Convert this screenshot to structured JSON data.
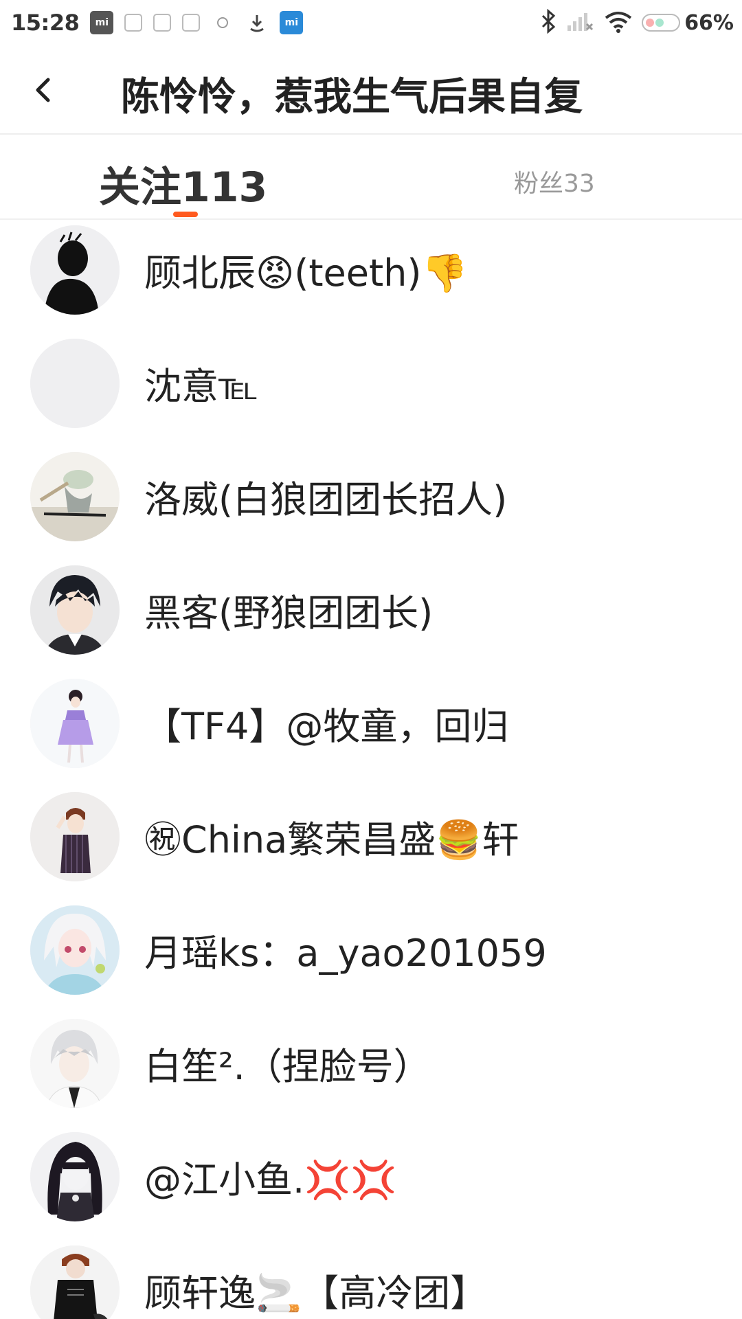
{
  "status_bar": {
    "time": "15:28",
    "battery": "66%",
    "notification_icons": [
      "mi-app-icon",
      "app-icon",
      "app-icon",
      "image-icon",
      "circle-icon",
      "download-icon",
      "mi-store-icon"
    ]
  },
  "header": {
    "title": "陈怜怜，惹我生气后果自复"
  },
  "tabs": {
    "following": "关注113",
    "fans": "粉丝33",
    "accent": "#ff5a1f"
  },
  "users": [
    {
      "name": "顾北辰😡(teeth)👎",
      "avatar": "silhouette"
    },
    {
      "name": "沈意℡",
      "avatar": "blank"
    },
    {
      "name": "洛威(白狼团团长招人)",
      "avatar": "anime-figure"
    },
    {
      "name": "黑客(野狼团团长)",
      "avatar": "anime-boy-dark-hair"
    },
    {
      "name": "【TF4】@牧童，回归",
      "avatar": "anime-girl-purple-dress"
    },
    {
      "name": "㊗China繁荣昌盛🍔轩",
      "avatar": "anime-boy-brown-hair"
    },
    {
      "name": "月瑶ks：a_yao201059",
      "avatar": "anime-girl-white-hair"
    },
    {
      "name": "白笙².（捏脸号）",
      "avatar": "anime-boy-silver-hair"
    },
    {
      "name": "@江小鱼.💢💢",
      "avatar": "anime-girl-dark"
    },
    {
      "name": "顾轩逸🚬【高冷团】",
      "avatar": "anime-boy-black-outfit"
    }
  ]
}
